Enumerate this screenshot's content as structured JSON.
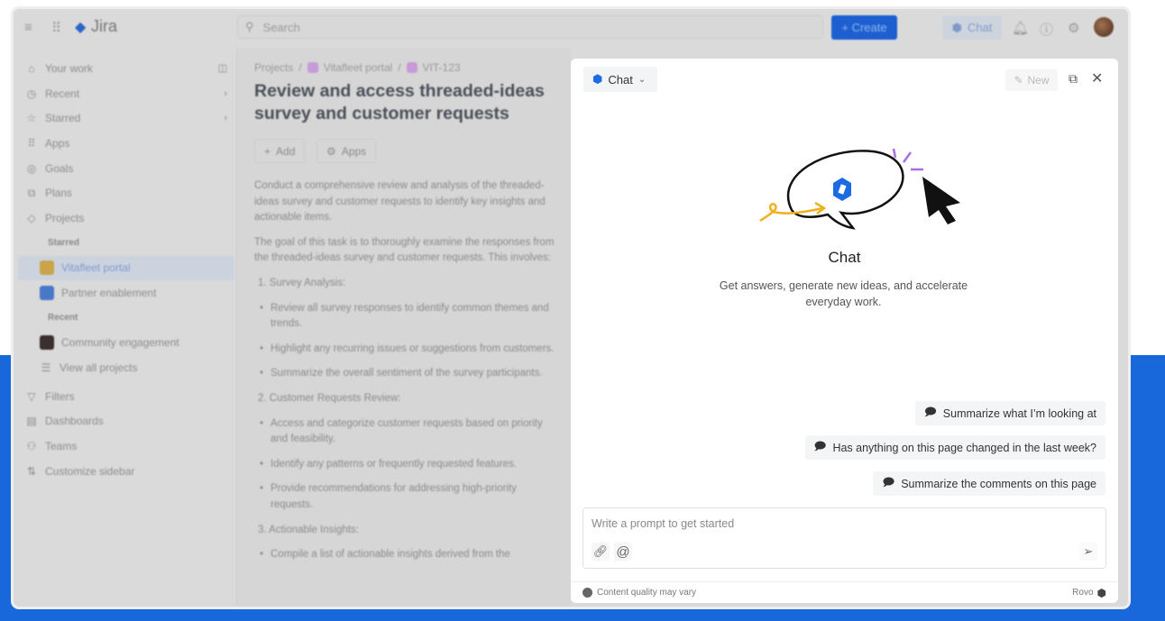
{
  "app": {
    "name": "Jira"
  },
  "topnav": {
    "search_placeholder": "Search",
    "create_label": "+ Create",
    "chat_label": "Chat"
  },
  "sidebar": {
    "items": [
      {
        "label": "Your work",
        "icon": "⌂"
      },
      {
        "label": "Recent",
        "icon": "◷"
      },
      {
        "label": "Starred",
        "icon": "☆"
      },
      {
        "label": "Apps",
        "icon": "⠿"
      },
      {
        "label": "Goals",
        "icon": "◎"
      },
      {
        "label": "Plans",
        "icon": "⧉"
      },
      {
        "label": "Projects",
        "icon": "◇"
      }
    ],
    "starred_heading": "Starred",
    "starred": [
      "Vitafleet portal",
      "Partner enablement"
    ],
    "recent_heading": "Recent",
    "recent": [
      "Community engagement"
    ],
    "view_all": "View all projects",
    "bottom": [
      {
        "label": "Filters",
        "icon": "▽"
      },
      {
        "label": "Dashboards",
        "icon": "▤"
      },
      {
        "label": "Teams",
        "icon": "⚇"
      },
      {
        "label": "Customize sidebar",
        "icon": "⇅"
      }
    ]
  },
  "issue": {
    "breadcrumb": [
      "Projects",
      "Vitafleet portal",
      "VIT-123"
    ],
    "title": "Review and access threaded-ideas survey and customer requests",
    "add_label": "Add",
    "apps_label": "Apps",
    "p1": "Conduct a comprehensive review and analysis of the threaded-ideas survey and customer requests to identify key insights and actionable items.",
    "p2": "The goal of this task is to thoroughly examine the responses from the threaded-ideas survey and customer requests. This involves:",
    "s1": "1. Survey Analysis:",
    "s1_items": [
      "Review all survey responses to identify common themes and trends.",
      "Highlight any recurring issues or suggestions from customers.",
      "Summarize the overall sentiment of the survey participants."
    ],
    "s2": "2. Customer Requests Review:",
    "s2_items": [
      "Access and categorize customer requests based on priority and feasibility.",
      "Identify any patterns or frequently requested features.",
      "Provide recommendations for addressing high-priority requests."
    ],
    "s3": "3. Actionable Insights:",
    "s3_items": [
      "Compile a list of actionable insights derived from the"
    ]
  },
  "chat": {
    "selector_label": "Chat",
    "new_label": "New",
    "title": "Chat",
    "subtitle": "Get answers, generate new ideas, and accelerate everyday work.",
    "suggestions": [
      "Summarize what I’m looking at",
      "Has anything on this page changed in the last week?",
      "Summarize the comments on this page"
    ],
    "prompt_placeholder": "Write a prompt to get started",
    "footer_note": "Content quality may vary",
    "brand": "Rovo"
  },
  "colors": {
    "brand_blue": "#1868db",
    "rovo_blue": "#1d6ae5"
  }
}
